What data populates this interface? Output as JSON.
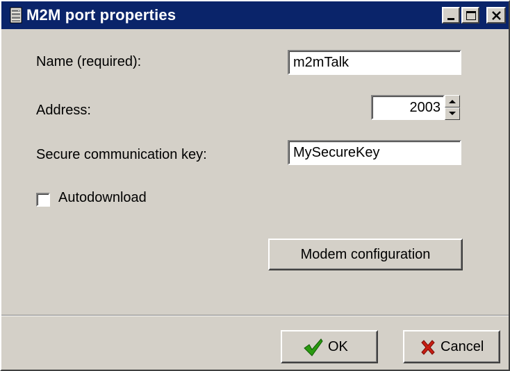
{
  "window": {
    "title": "M2M port properties"
  },
  "form": {
    "name_label": "Name (required):",
    "name_value": "m2mTalk",
    "address_label": "Address:",
    "address_value": "2003",
    "key_label": "Secure communication key:",
    "key_value": "MySecureKey",
    "autodownload_label": "Autodownload",
    "autodownload_checked": false
  },
  "buttons": {
    "modem_config": "Modem configuration",
    "ok": "OK",
    "cancel": "Cancel"
  },
  "icons": {
    "title": "database-icon",
    "minimize": "minimize-icon",
    "maximize": "maximize-icon",
    "close": "close-icon",
    "ok": "checkmark-icon",
    "cancel": "x-icon"
  },
  "colors": {
    "titlebar": "#0a246a",
    "face": "#d4d0c8",
    "ok_check": "#2a9a10",
    "cancel_x": "#c81e12"
  }
}
